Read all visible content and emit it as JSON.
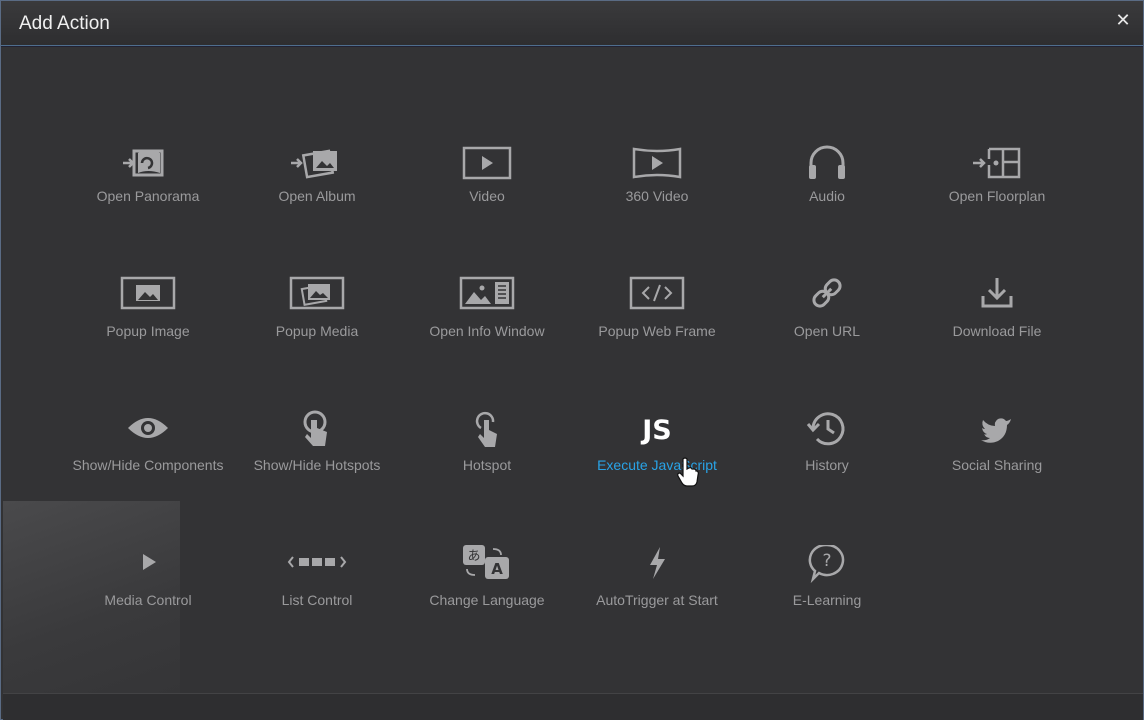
{
  "dialog": {
    "title": "Add Action",
    "close_glyph": "✕"
  },
  "actions": [
    {
      "label": "Open Panorama",
      "icon": "open-panorama-icon"
    },
    {
      "label": "Open Album",
      "icon": "open-album-icon"
    },
    {
      "label": "Video",
      "icon": "video-icon"
    },
    {
      "label": "360 Video",
      "icon": "video-360-icon"
    },
    {
      "label": "Audio",
      "icon": "headphones-icon"
    },
    {
      "label": "Open Floorplan",
      "icon": "floorplan-icon"
    },
    {
      "label": "Popup Image",
      "icon": "image-icon"
    },
    {
      "label": "Popup Media",
      "icon": "media-icon"
    },
    {
      "label": "Open Info Window",
      "icon": "info-window-icon"
    },
    {
      "label": "Popup Web Frame",
      "icon": "code-icon"
    },
    {
      "label": "Open URL",
      "icon": "link-icon"
    },
    {
      "label": "Download File",
      "icon": "download-icon"
    },
    {
      "label": "Show/Hide Components",
      "icon": "eye-icon"
    },
    {
      "label": "Show/Hide Hotspots",
      "icon": "hand-tap-icon"
    },
    {
      "label": "Hotspot",
      "icon": "hand-pointer-icon"
    },
    {
      "label": "Execute JavaScript",
      "icon": "javascript-icon",
      "icon_text": "JS",
      "state": "hovered"
    },
    {
      "label": "History",
      "icon": "history-icon"
    },
    {
      "label": "Social Sharing",
      "icon": "twitter-icon"
    },
    {
      "label": "Media Control",
      "icon": "play-icon",
      "state": "selected"
    },
    {
      "label": "List Control",
      "icon": "list-control-icon"
    },
    {
      "label": "Change Language",
      "icon": "translate-icon"
    },
    {
      "label": "AutoTrigger at Start",
      "icon": "lightning-icon"
    },
    {
      "label": "E-Learning",
      "icon": "question-icon"
    }
  ],
  "colors": {
    "background": "#333335",
    "label": "#9a9a9c",
    "icon": "#a8a8aa",
    "hover_label": "#29a3e6",
    "title": "#f0f0f0"
  }
}
